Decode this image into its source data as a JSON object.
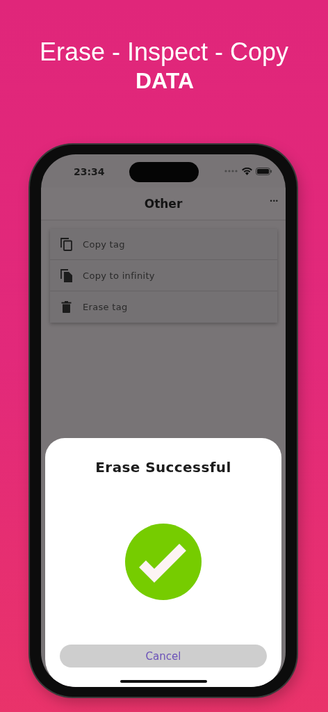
{
  "headline": {
    "line_1": "Erase - Inspect - Copy",
    "line_2": "DATA"
  },
  "status_bar": {
    "time": "23:34"
  },
  "nav_bar": {
    "title": "Other",
    "menu": "•••"
  },
  "menu_items": [
    {
      "kind": "copy",
      "label": "Copy tag"
    },
    {
      "kind": "copy-file",
      "label": "Copy to infinity"
    },
    {
      "kind": "erase",
      "label": "Erase tag"
    }
  ],
  "sheet": {
    "title": "Erase Successful",
    "success": true,
    "button": "Cancel"
  }
}
